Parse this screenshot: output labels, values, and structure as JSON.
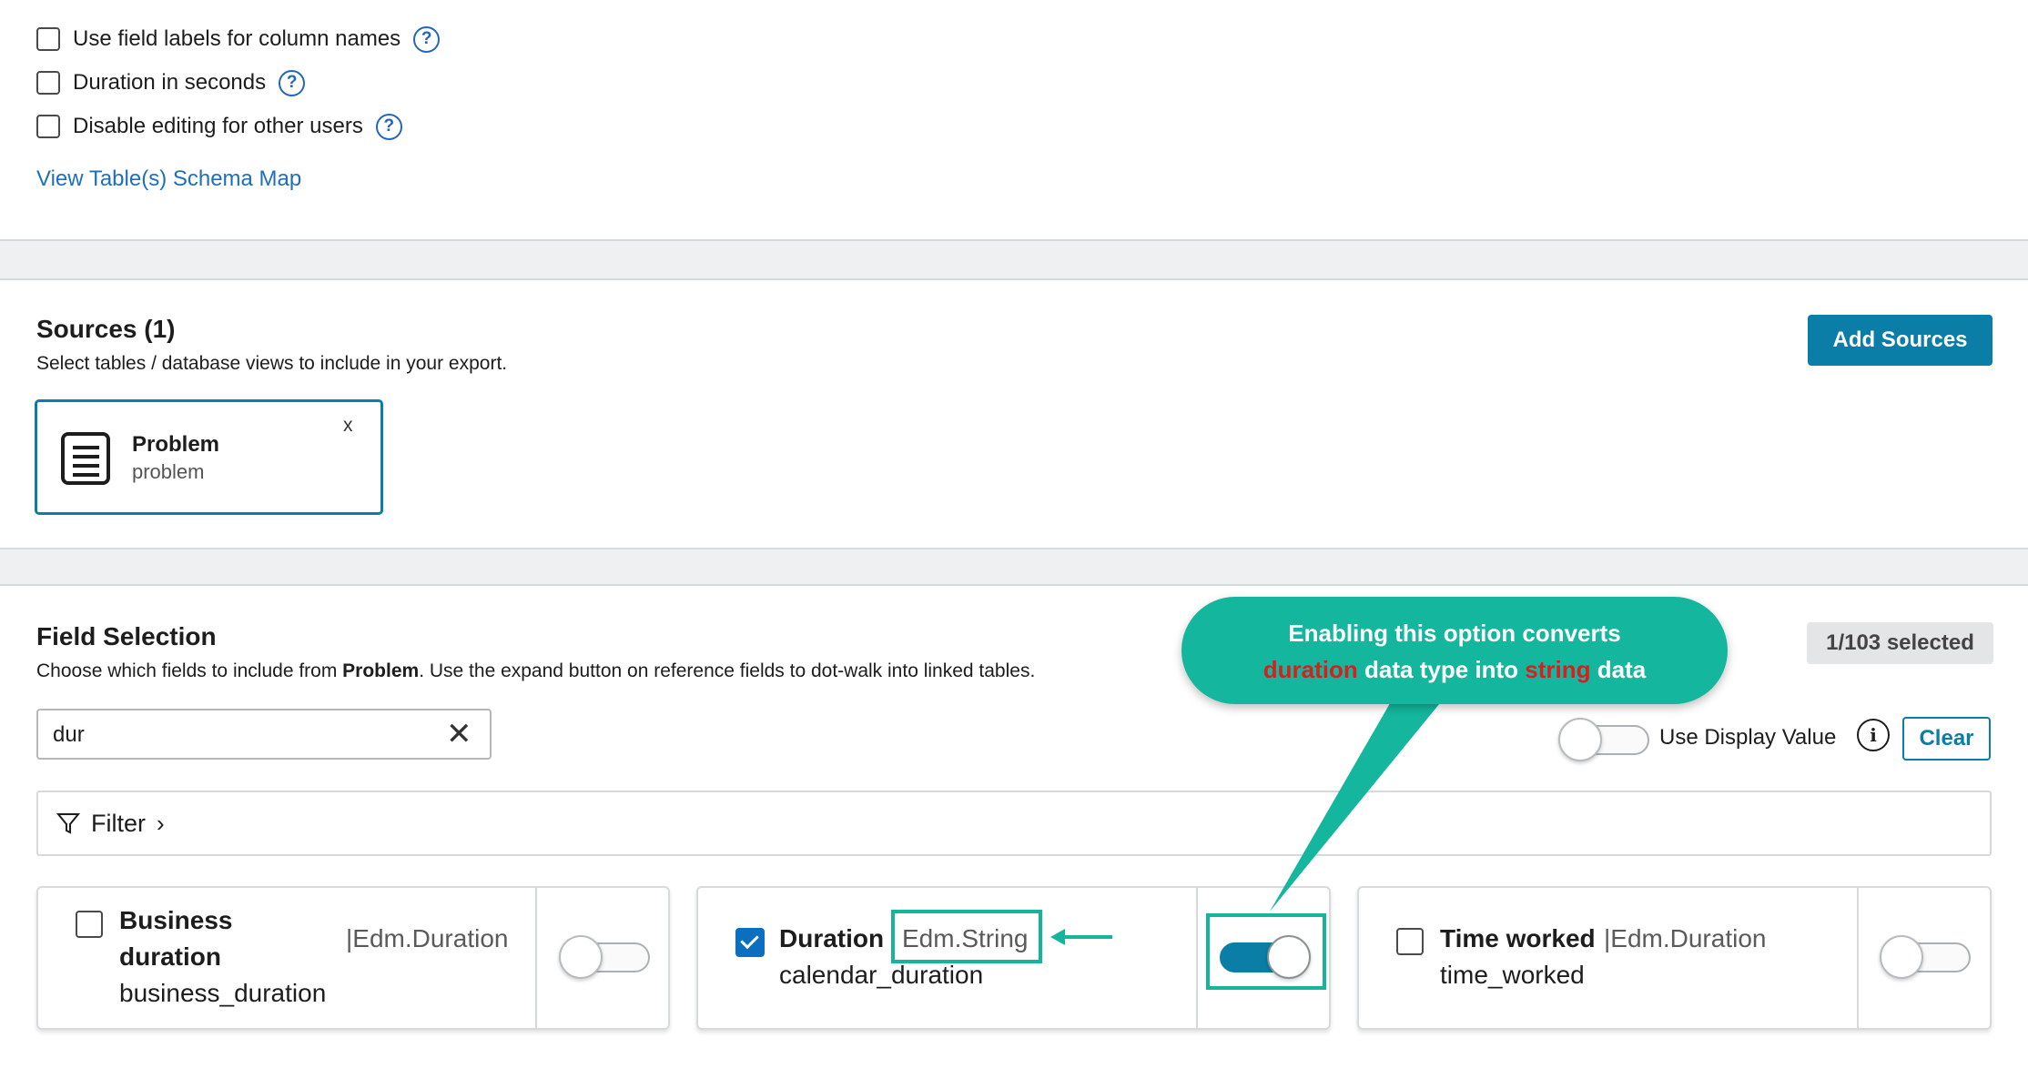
{
  "options": {
    "items": [
      {
        "label": "Use field labels for column names",
        "checked": false
      },
      {
        "label": "Duration in seconds",
        "checked": false
      },
      {
        "label": "Disable editing for other users",
        "checked": false
      }
    ],
    "help_icon": "?",
    "schema_link": "View Table(s) Schema Map"
  },
  "sources": {
    "title": "Sources (1)",
    "description": "Select tables / database views to include in your export.",
    "add_button": "Add Sources",
    "card": {
      "name": "Problem",
      "table": "problem",
      "remove": "x",
      "icon": "table-list-icon"
    }
  },
  "field_selection": {
    "title": "Field Selection",
    "description_pre": "Choose which fields to include from ",
    "description_bold": "Problem",
    "description_post": ". Use the expand button on reference fields to dot-walk into linked tables.",
    "selected_count": "1/103 selected",
    "search_value": "dur",
    "display_value_label": "Use Display Value",
    "display_value_on": false,
    "info_icon": "i",
    "clear_button": "Clear",
    "filter_label": "Filter",
    "fields": [
      {
        "name_line1": "Business",
        "name_line2": "duration",
        "type": "|Edm.Duration",
        "key": "business_duration",
        "checked": false,
        "toggle_on": false
      },
      {
        "name": "Duration",
        "type": "Edm.String",
        "key": "calendar_duration",
        "checked": true,
        "toggle_on": true
      },
      {
        "name": "Time worked",
        "type": "|Edm.Duration",
        "key": "time_worked",
        "checked": false,
        "toggle_on": false
      }
    ]
  },
  "callout": {
    "line1": "Enabling this option converts",
    "red1": "duration",
    "mid": " data type into ",
    "red2": "string",
    "end": " data",
    "accent_color": "#14b79e",
    "highlight_color": "#d61f1f"
  },
  "colors": {
    "primary": "#0a7ea6",
    "link": "#1e6fbd"
  }
}
